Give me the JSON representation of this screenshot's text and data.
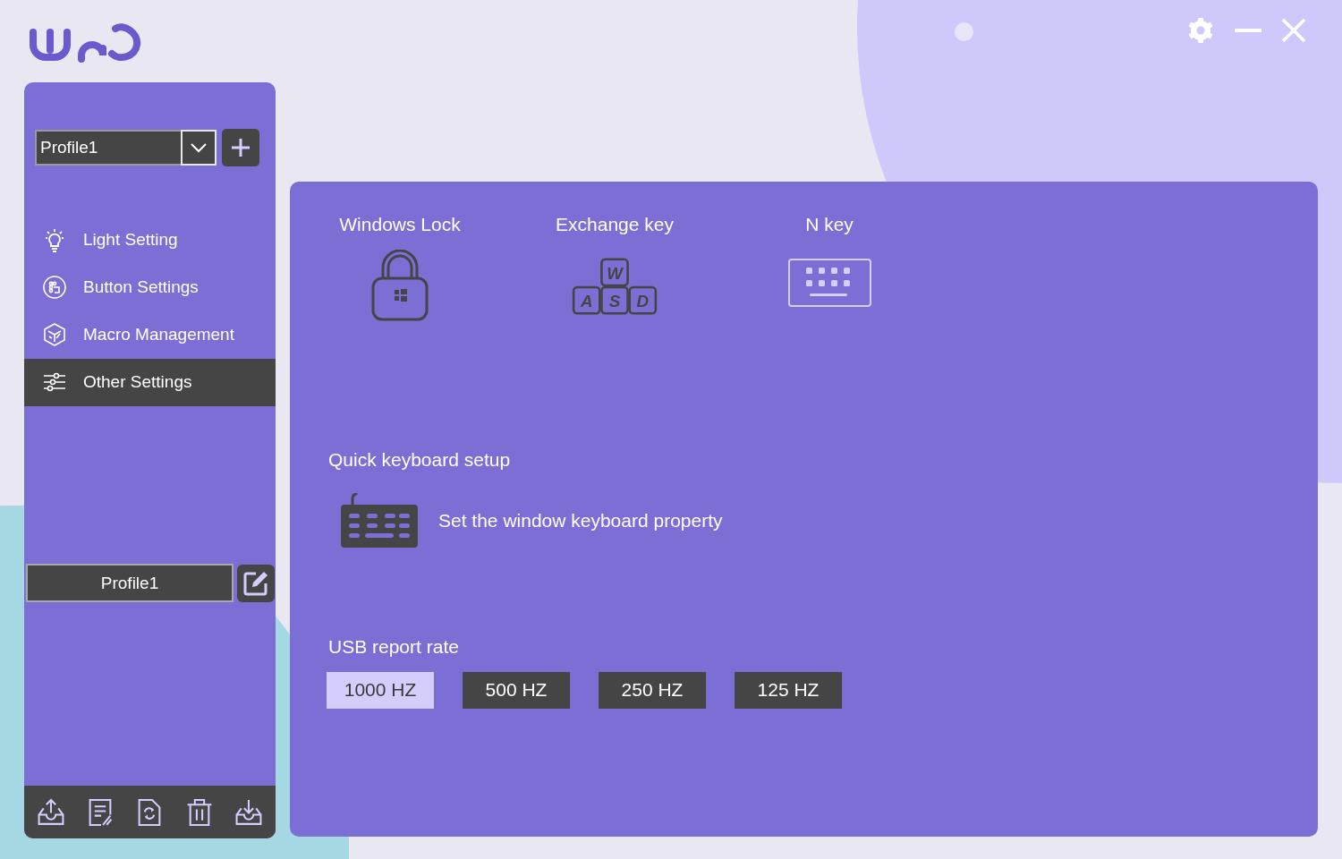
{
  "profile_select": {
    "value": "Profile1"
  },
  "nav": [
    {
      "label": "Light Setting",
      "selected": false
    },
    {
      "label": "Button Settings",
      "selected": false
    },
    {
      "label": "Macro Management",
      "selected": false
    },
    {
      "label": "Other Settings",
      "selected": true
    }
  ],
  "profile_name": "Profile1",
  "features": [
    {
      "title": "Windows Lock"
    },
    {
      "title": "Exchange key",
      "keys": [
        "W",
        "A",
        "S",
        "D"
      ]
    },
    {
      "title": "N key"
    }
  ],
  "quick_setup": {
    "title": "Quick keyboard setup",
    "action": "Set the window keyboard property"
  },
  "usb_report_rate": {
    "title": "USB report rate",
    "options": [
      {
        "label": "1000 HZ",
        "selected": true
      },
      {
        "label": "500 HZ",
        "selected": false
      },
      {
        "label": "250 HZ",
        "selected": false
      },
      {
        "label": "125 HZ",
        "selected": false
      }
    ]
  }
}
